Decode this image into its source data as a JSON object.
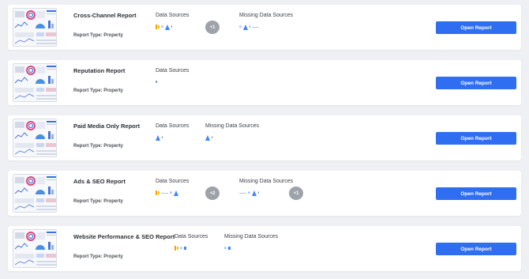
{
  "reports": [
    {
      "title": "Cross-Channel Report",
      "report_type": "Report Type: Property",
      "data_sources_label": "Data Sources",
      "data_sources": [
        "analytics",
        "google",
        "ads",
        "facebook"
      ],
      "data_sources_more": "+1",
      "missing_label": "Missing Data Sources",
      "missing_sources": [
        "google",
        "ads",
        "facebook",
        "text"
      ],
      "missing_more": "",
      "button_label": "Open Report"
    },
    {
      "title": "Reputation Report",
      "report_type": "Report Type: Property",
      "data_sources_label": "Data Sources",
      "data_sources": [
        "reputation"
      ],
      "data_sources_more": "",
      "missing_label": "",
      "missing_sources": [],
      "missing_more": "",
      "button_label": "Open Report"
    },
    {
      "title": "Paid Media Only Report",
      "report_type": "Report Type: Property",
      "data_sources_label": "Data Sources",
      "data_sources": [
        "ads",
        "facebook"
      ],
      "data_sources_more": "",
      "missing_label": "Missing Data Sources",
      "missing_sources": [
        "ads",
        "facebook"
      ],
      "missing_more": "",
      "button_label": "Open Report"
    },
    {
      "title": "Ads & SEO Report",
      "report_type": "Report Type: Property",
      "data_sources_label": "Data Sources",
      "data_sources": [
        "analytics",
        "text",
        "google",
        "ads"
      ],
      "data_sources_more": "+2",
      "missing_label": "Missing Data Sources",
      "missing_sources": [
        "text",
        "google",
        "ads",
        "facebook"
      ],
      "missing_more": "+1",
      "button_label": "Open Report"
    },
    {
      "title": "Website Performance & SEO Report",
      "report_type": "Report Type: Property",
      "data_sources_label": "Data Sources",
      "data_sources": [
        "analytics",
        "google",
        "square"
      ],
      "data_sources_more": "",
      "missing_label": "Missing Data Sources",
      "missing_sources": [
        "google",
        "square"
      ],
      "missing_more": "",
      "button_label": "Open Report"
    }
  ],
  "colors": {
    "accent": "#2f6ef0",
    "page_bg": "#eef0f3",
    "card_bg": "#ffffff",
    "badge": "#9ea2a9"
  }
}
